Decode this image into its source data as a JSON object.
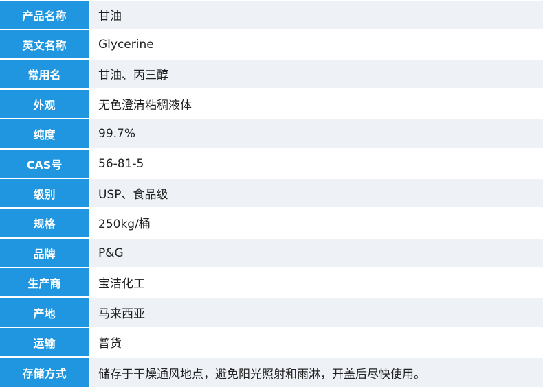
{
  "rows": [
    {
      "label": "产品名称",
      "value": "甘油"
    },
    {
      "label": "英文名称",
      "value": "Glycerine"
    },
    {
      "label": "常用名",
      "value": "甘油、丙三醇"
    },
    {
      "label": "外观",
      "value": "无色澄清粘稠液体"
    },
    {
      "label": "纯度",
      "value": "99.7%"
    },
    {
      "label": "CAS号",
      "value": "56-81-5"
    },
    {
      "label": "级别",
      "value": "USP、食品级"
    },
    {
      "label": "规格",
      "value": "250kg/桶"
    },
    {
      "label": "品牌",
      "value": "P&G"
    },
    {
      "label": "生产商",
      "value": "宝洁化工"
    },
    {
      "label": "产地",
      "value": "马来西亚"
    },
    {
      "label": "运输",
      "value": "普货"
    },
    {
      "label": "存储方式",
      "value": "储存于干燥通风地点，避免阳光照射和雨淋，开盖后尽快使用。"
    }
  ]
}
